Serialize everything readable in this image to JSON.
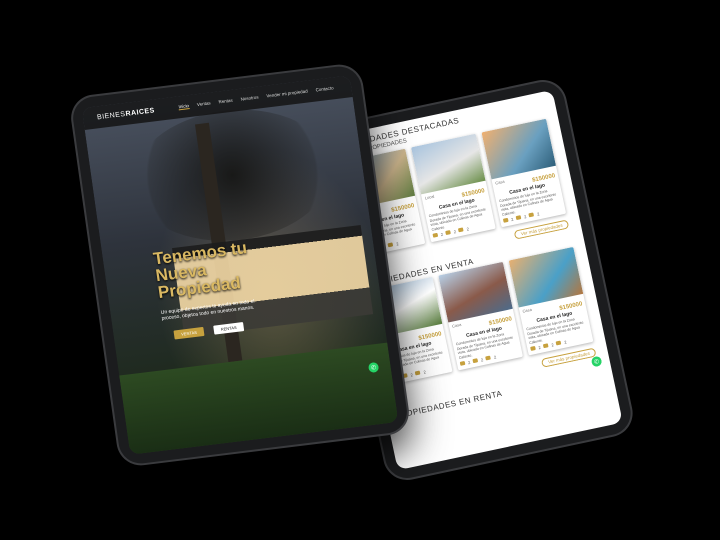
{
  "right_tablet": {
    "section1_title": "PROPIEDADES DESTACADAS",
    "section1_sub": "NUEVAS PROPIEDADES",
    "section2_title": "PROPIEDADES EN VENTA",
    "section3_title": "PROPIEDADES EN RENTA",
    "see_more": "Ver más propiedades",
    "cards_new": [
      {
        "tag": "Casa",
        "price": "$150000",
        "title": "Casa en el lago",
        "desc": "Condominios de lujo en la Zona Dorada de Tijuana, en una excelente vista, ubicado en Colinas de Agua Caliente."
      },
      {
        "tag": "Local",
        "price": "$150000",
        "title": "Casa en el lago",
        "desc": "Condominios de lujo en la Zona Dorada de Tijuana, en una excelente vista, ubicado en Colinas de Agua Caliente."
      },
      {
        "tag": "Casa",
        "price": "$150000",
        "title": "Casa en el lago",
        "desc": "Condominios de lujo en la Zona Dorada de Tijuana, en una excelente vista, ubicado en Colinas de Agua Caliente."
      }
    ],
    "cards_sale": [
      {
        "tag": "Casa",
        "price": "$150000",
        "title": "Casa en el lago",
        "desc": "Condominios de lujo en la Zona Dorada de Tijuana, en una excelente vista, ubicado en Colinas de Agua Caliente."
      },
      {
        "tag": "Casa",
        "price": "$150000",
        "title": "Casa en el lago",
        "desc": "Condominios de lujo en la Zona Dorada de Tijuana, en una excelente vista, ubicado en Colinas de Agua Caliente."
      },
      {
        "tag": "Casa",
        "price": "$150000",
        "title": "Casa en el lago",
        "desc": "Condominios de lujo en la Zona Dorada de Tijuana, en una excelente vista, ubicado en Colinas de Agua Caliente."
      }
    ],
    "icon_counts": {
      "bed": "2",
      "bath": "2",
      "car": "2"
    }
  },
  "left_tablet": {
    "logo_light": "BIENES",
    "logo_bold": "RAICES",
    "menu": [
      "Inicio",
      "Ventas",
      "Rentas",
      "Nosotros",
      "Vender mi propiedad",
      "Contacto"
    ],
    "headline": "Tenemos tu Nueva Propiedad",
    "tagline": "Un equipo de expertos te ayuda en todo el proceso, objetos todo en nuestros manos.",
    "btn_sale": "VENTAS",
    "btn_rent": "RENTAS"
  },
  "colors": {
    "gold": "#c7a13e",
    "whatsapp": "#25d366"
  }
}
